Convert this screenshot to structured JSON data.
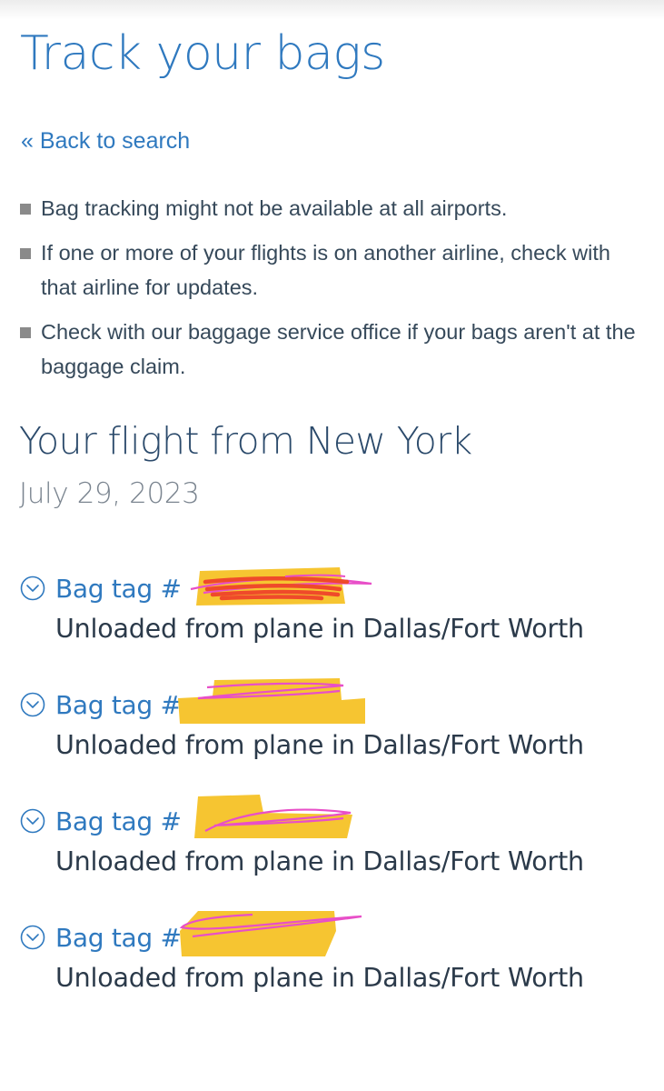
{
  "page": {
    "title": "Track your bags",
    "back_link": "« Back to search"
  },
  "notes": [
    "Bag tracking might not be available at all airports.",
    "If one or more of your flights is on another airline, check with that airline for updates.",
    "Check with our baggage service office if your bags aren't at the baggage claim."
  ],
  "flight": {
    "title": "Your flight from New York",
    "date": "July 29, 2023"
  },
  "bags": [
    {
      "label": "Bag tag #",
      "status": "Unloaded from plane in Dallas/Fort Worth"
    },
    {
      "label": "Bag tag #",
      "status": "Unloaded from plane in Dallas/Fort Worth"
    },
    {
      "label": "Bag tag #",
      "status": "Unloaded from plane in Dallas/Fort Worth"
    },
    {
      "label": "Bag tag #",
      "status": "Unloaded from plane in Dallas/Fort Worth"
    }
  ],
  "icons": {
    "expand": "chevron-down-circle-icon"
  },
  "colors": {
    "link_blue": "#2f79bf",
    "heading_navy": "#2b4a6b",
    "redaction_yellow": "#f6c531",
    "redaction_pink": "#e84fc8",
    "redaction_red": "#ef4a2a"
  }
}
